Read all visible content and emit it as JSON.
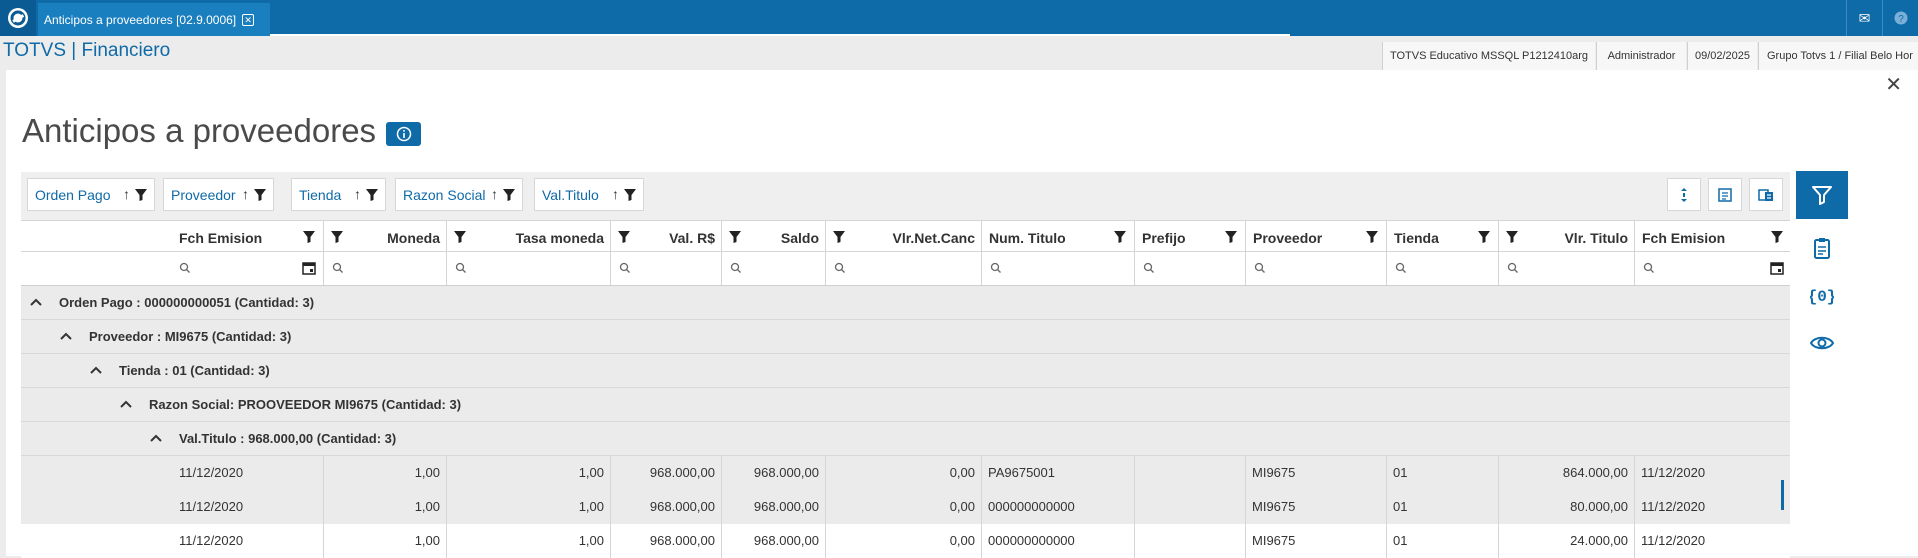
{
  "colors": {
    "brand": "#0f6aa8",
    "topbar": "#0f6aa8"
  },
  "topbar": {
    "tab_label": "Anticipos a proveedores [02.9.0006]",
    "icons": [
      "mail-icon",
      "help-icon"
    ]
  },
  "appbar": {
    "title": "TOTVS | Financiero",
    "environment": "TOTVS Educativo MSSQL P1212410arg",
    "user": "Administrador",
    "date": "09/02/2025",
    "branch": "Grupo Totvs 1 / Filial Belo Hor"
  },
  "page": {
    "title": "Anticipos a proveedores"
  },
  "group_chips": [
    "Orden Pago",
    "Proveedor",
    "Tienda",
    "Razon Social",
    "Val.Titulo"
  ],
  "columns": [
    "Fch Emision",
    "Moneda",
    "Tasa moneda",
    "Val. R$",
    "Saldo",
    "Vlr.Net.Canc",
    "Num. Titulo",
    "Prefijo",
    "Proveedor",
    "Tienda",
    "Vlr. Titulo",
    "Fch Emision"
  ],
  "groups": [
    "Orden Pago : 000000000051 (Cantidad: 3)",
    "Proveedor : MI9675 (Cantidad: 3)",
    "Tienda : 01 (Cantidad: 3)",
    "Razon Social: PROOVEEDOR MI9675 (Cantidad: 3)",
    "Val.Titulo : 968.000,00 (Cantidad: 3)"
  ],
  "rows": [
    [
      "11/12/2020",
      "1,00",
      "1,00",
      "968.000,00",
      "968.000,00",
      "0,00",
      "PA9675001",
      "",
      "MI9675",
      "01",
      "864.000,00",
      "11/12/2020"
    ],
    [
      "11/12/2020",
      "1,00",
      "1,00",
      "968.000,00",
      "968.000,00",
      "0,00",
      "000000000000",
      "",
      "MI9675",
      "01",
      "80.000,00",
      "11/12/2020"
    ],
    [
      "11/12/2020",
      "1,00",
      "1,00",
      "968.000,00",
      "968.000,00",
      "0,00",
      "000000000000",
      "",
      "MI9675",
      "01",
      "24.000,00",
      "11/12/2020"
    ]
  ],
  "sidebar_icons": [
    "filter-icon",
    "clipboard-icon",
    "braces-icon",
    "eye-icon"
  ]
}
